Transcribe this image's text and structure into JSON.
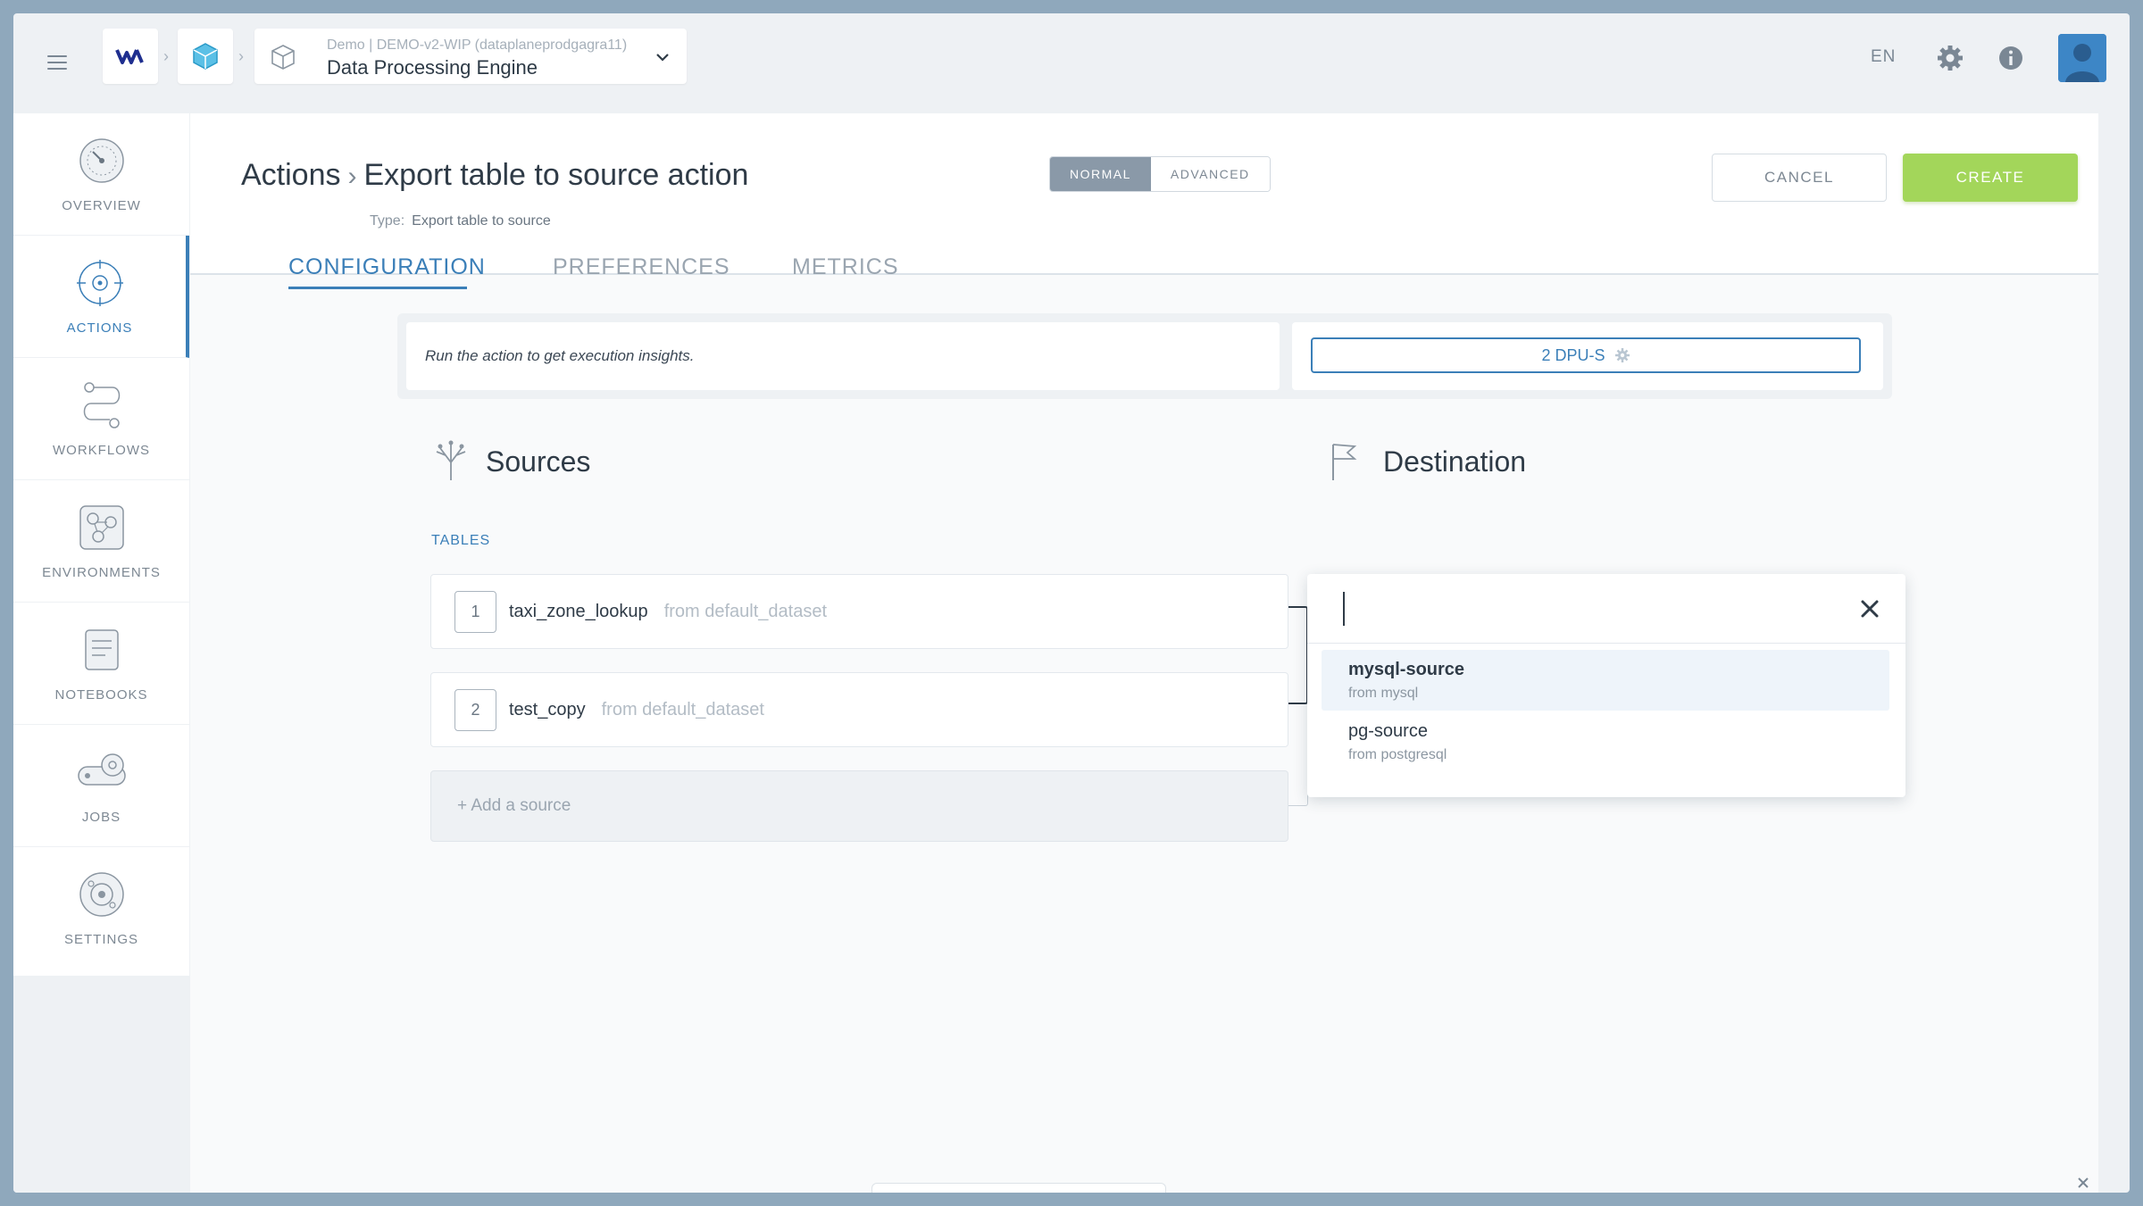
{
  "topbar": {
    "project_sub": "Demo | DEMO-v2-WIP (dataplaneprodgagra11)",
    "project_title": "Data Processing Engine",
    "language": "EN",
    "icons": [
      "menu-icon",
      "logo-icon",
      "cube-icon",
      "box-icon",
      "chevron-down-icon",
      "gear-icon",
      "info-icon",
      "avatar"
    ]
  },
  "sidebar": {
    "items": [
      {
        "label": "OVERVIEW",
        "icon": "overview-gauge-icon",
        "active": false
      },
      {
        "label": "ACTIONS",
        "icon": "actions-target-icon",
        "active": true
      },
      {
        "label": "WORKFLOWS",
        "icon": "workflows-icon",
        "active": false
      },
      {
        "label": "ENVIRONMENTS",
        "icon": "environments-icon",
        "active": false
      },
      {
        "label": "NOTEBOOKS",
        "icon": "notebooks-icon",
        "active": false
      },
      {
        "label": "JOBS",
        "icon": "jobs-icon",
        "active": false
      },
      {
        "label": "SETTINGS",
        "icon": "settings-icon",
        "active": false
      }
    ]
  },
  "header": {
    "breadcrumb_parent": "Actions",
    "breadcrumb_current": "Export table to source action",
    "type_label": "Type:",
    "type_value": "Export table to source",
    "mode_normal": "NORMAL",
    "mode_advanced": "ADVANCED",
    "cancel_label": "CANCEL",
    "create_label": "CREATE"
  },
  "tabs": [
    {
      "label": "CONFIGURATION",
      "active": true
    },
    {
      "label": "PREFERENCES",
      "active": false
    },
    {
      "label": "METRICS",
      "active": false
    }
  ],
  "insights": {
    "message": "Run the action to get execution insights.",
    "dpu_label": "2 DPU-S"
  },
  "sources": {
    "title": "Sources",
    "tables_label": "TABLES",
    "tables": [
      {
        "num": "1",
        "name": "taxi_zone_lookup",
        "from": "from default_dataset"
      },
      {
        "num": "2",
        "name": "test_copy",
        "from": "from default_dataset"
      }
    ],
    "add_label": "+ Add a source"
  },
  "destination": {
    "title": "Destination",
    "search_value": "",
    "options": [
      {
        "name": "mysql-source",
        "sub": "from mysql",
        "highlighted": true
      },
      {
        "name": "pg-source",
        "sub": "from postgresql",
        "highlighted": false
      }
    ]
  },
  "colors": {
    "accent": "#3b7fb8",
    "create": "#a3d65a",
    "frame": "#8fa8bc"
  }
}
